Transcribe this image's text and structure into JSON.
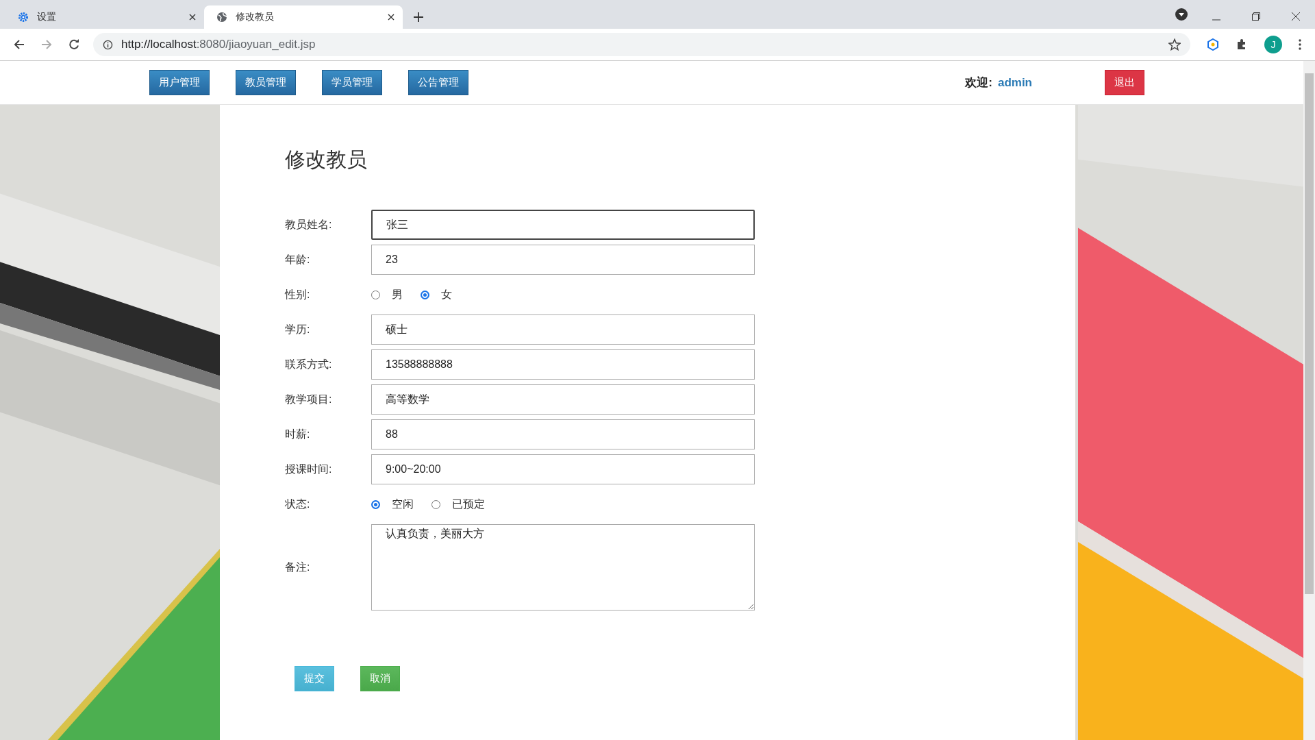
{
  "tabs": [
    {
      "title": "设置",
      "kind": "settings",
      "selected": false
    },
    {
      "title": "修改教员",
      "kind": "web",
      "selected": true
    }
  ],
  "address_bar": {
    "url_host": "http://localhost",
    "url_rest": ":8080/jiaoyuan_edit.jsp"
  },
  "profile_initial": "J",
  "nav": {
    "buttons": [
      "用户管理",
      "教员管理",
      "学员管理",
      "公告管理"
    ],
    "welcome_label": "欢迎:",
    "username": "admin",
    "logout": "退出"
  },
  "form": {
    "title": "修改教员",
    "fields": [
      {
        "label": "教员姓名:",
        "kind": "text",
        "value": "张三",
        "focused": true
      },
      {
        "label": "年龄:",
        "kind": "text",
        "value": "23",
        "focused": false
      },
      {
        "label": "性别:",
        "kind": "radio",
        "options": [
          {
            "label": "男",
            "selected": false
          },
          {
            "label": "女",
            "selected": true
          }
        ]
      },
      {
        "label": "学历:",
        "kind": "text",
        "value": "硕士",
        "focused": false
      },
      {
        "label": "联系方式:",
        "kind": "text",
        "value": "13588888888",
        "focused": false
      },
      {
        "label": "教学项目:",
        "kind": "text",
        "value": "高等数学",
        "focused": false
      },
      {
        "label": "时薪:",
        "kind": "text",
        "value": "88",
        "focused": false
      },
      {
        "label": "授课时间:",
        "kind": "text",
        "value": "9:00~20:00",
        "focused": false
      },
      {
        "label": "状态:",
        "kind": "radio",
        "options": [
          {
            "label": "空闲",
            "selected": true
          },
          {
            "label": "已预定",
            "selected": false
          }
        ]
      },
      {
        "label": "备注:",
        "kind": "textarea",
        "value": "认真负责，美丽大方"
      }
    ],
    "submit": "提交",
    "cancel": "取消"
  }
}
